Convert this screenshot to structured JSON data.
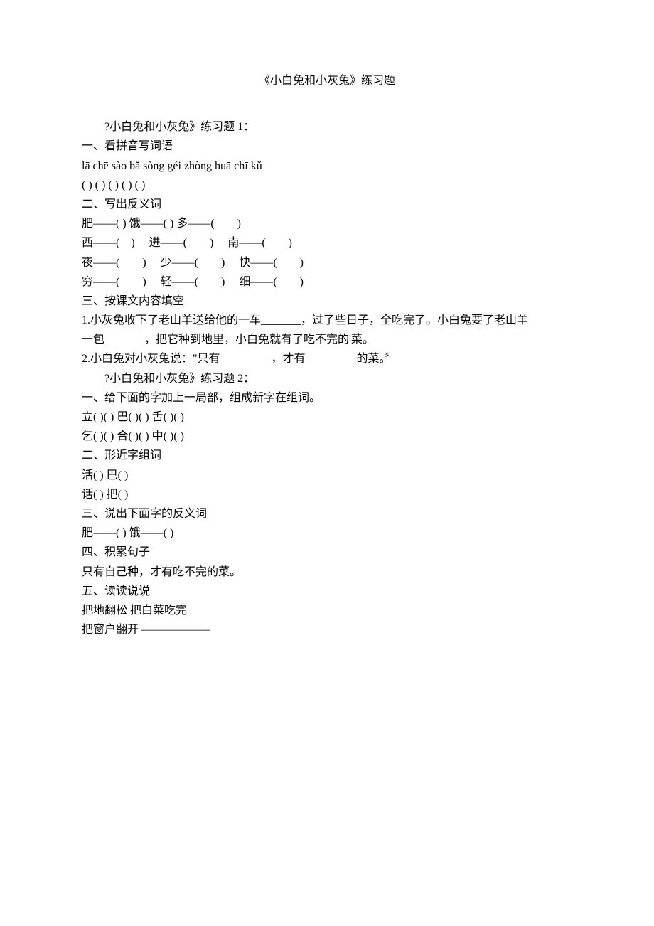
{
  "title": "《小白兔和小灰兔》练习题",
  "lines": [
    {
      "cls": "indent",
      "text": "?小白兔和小灰兔》练习题 1："
    },
    {
      "cls": "",
      "text": "一、看拼音写词语"
    },
    {
      "cls": "",
      "text": "lā chē sào bǎ sòng géi zhòng huā chī kǔ"
    },
    {
      "cls": "",
      "text": "( ) ( ) ( ) ( ) ( )"
    },
    {
      "cls": "",
      "text": "二、写出反义词"
    },
    {
      "cls": "",
      "text": "肥——( )  饿——( )  多——(　　)"
    },
    {
      "cls": "",
      "text": "西——(　)　 进——(　　)　 南——(　　)"
    },
    {
      "cls": "",
      "text": "夜——(　　)　 少——(　　)　 快——(　　)"
    },
    {
      "cls": "",
      "text": "穷——(　　)　 轻——(　　)　 细——(　　)"
    },
    {
      "cls": "",
      "text": "三、按课文内容填空"
    },
    {
      "cls": "",
      "text": "1.小灰兔收下了老山羊送给他的一车_______，过了些日子，全吃完了。小白兔要了老山羊"
    },
    {
      "cls": "",
      "text": "一包_______，把它种到地里，小白兔就有了吃不完的'菜。"
    },
    {
      "cls": "",
      "text": "2.小白兔对小灰兔说：\"只有_________，才有_________的菜。〞"
    },
    {
      "cls": "indent",
      "text": "?小白兔和小灰兔》练习题 2："
    },
    {
      "cls": "",
      "text": "一、给下面的字加上一局部，组成新字在组词。"
    },
    {
      "cls": "",
      "text": "立( )( )  巴( )( )  舌( )( )"
    },
    {
      "cls": "",
      "text": "乞( )( )  合( )( )  中( )( )"
    },
    {
      "cls": "",
      "text": "二、形近字组词"
    },
    {
      "cls": "",
      "text": "活( )  巴( )"
    },
    {
      "cls": "",
      "text": "话( )  把( )"
    },
    {
      "cls": "",
      "text": "三、说出下面字的反义词"
    },
    {
      "cls": "",
      "text": "肥——( )  饿——( )"
    },
    {
      "cls": "",
      "text": "四、积累句子"
    },
    {
      "cls": "",
      "text": "只有自己种，才有吃不完的菜。"
    },
    {
      "cls": "",
      "text": "五、读读说说"
    },
    {
      "cls": "",
      "text": "把地翻松  把白菜吃完"
    },
    {
      "cls": "",
      "text": "把窗户翻开  ——————"
    }
  ]
}
